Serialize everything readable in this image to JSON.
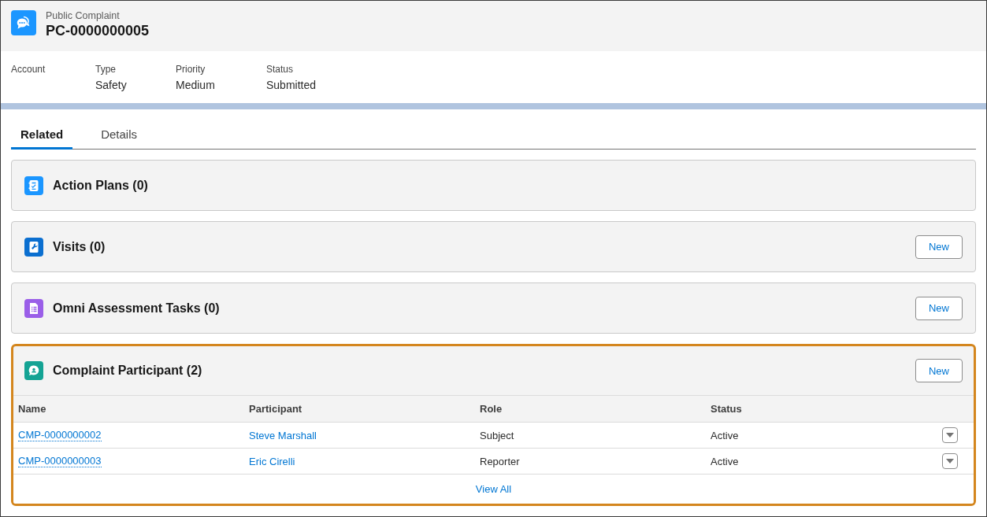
{
  "record": {
    "object_type": "Public Complaint",
    "title": "PC-0000000005"
  },
  "highlights": [
    {
      "label": "Account"
    },
    {
      "label": "Type",
      "value": "Safety"
    },
    {
      "label": "Priority",
      "value": "Medium"
    },
    {
      "label": "Status",
      "value": "Submitted"
    }
  ],
  "tabs": [
    {
      "label": "Related",
      "selected": true
    },
    {
      "label": "Details",
      "selected": false
    }
  ],
  "cards": [
    {
      "title": "Action Plans (0)",
      "color": "#1b96ff",
      "highlighted": false
    },
    {
      "title": "Visits (0)",
      "color": "#0b6fd0",
      "new_button": "New",
      "highlighted": false
    },
    {
      "title": "Omni Assessment Tasks (0)",
      "color": "#9a5ee8",
      "new_button": "New",
      "highlighted": false
    },
    {
      "title": "Complaint Participant (2)",
      "color": "#14a394",
      "new_button": "New",
      "highlighted": true,
      "table": {
        "columns": [
          {
            "label": "Name",
            "kind": "record_link"
          },
          {
            "label": "Participant",
            "kind": "link"
          },
          {
            "label": "Role",
            "kind": "text"
          },
          {
            "label": "Status",
            "kind": "text"
          }
        ],
        "rows": [
          {
            "cells": [
              "CMP-0000000002",
              "Steve Marshall",
              "Subject",
              "Active"
            ]
          },
          {
            "cells": [
              "CMP-0000000003",
              "Eric Cirelli",
              "Reporter",
              "Active"
            ]
          }
        ],
        "view_all": "View All"
      }
    }
  ]
}
